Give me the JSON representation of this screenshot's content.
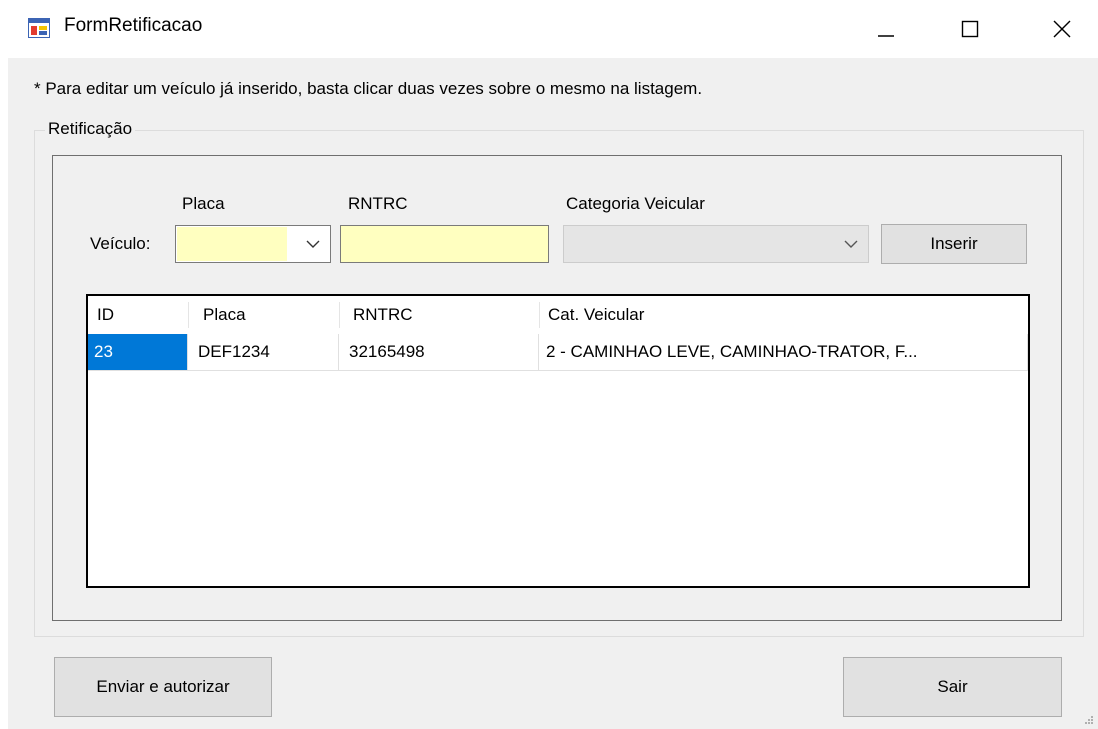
{
  "window": {
    "title": "FormRetificacao",
    "icon": "form-app-icon",
    "controls": [
      "minimize-icon",
      "maximize-icon",
      "close-icon"
    ]
  },
  "hint": "* Para editar um veículo já inserido, basta clicar duas vezes sobre o mesmo na listagem.",
  "group": {
    "label": "Retificação"
  },
  "form": {
    "veiculo_label": "Veículo:",
    "placa_label": "Placa",
    "placa_value": "",
    "rntrc_label": "RNTRC",
    "rntrc_value": "",
    "categoria_label": "Categoria Veicular",
    "categoria_value": "",
    "inserir_label": "Inserir"
  },
  "table": {
    "columns": [
      "ID",
      "Placa",
      "RNTRC",
      "Cat. Veicular"
    ],
    "rows": [
      [
        "23",
        "DEF1234",
        "32165498",
        "2 - CAMINHAO LEVE, CAMINHAO-TRATOR, F..."
      ]
    ]
  },
  "buttons": {
    "enviar_label": "Enviar e autorizar",
    "sair_label": "Sair"
  },
  "colors": {
    "input_required": "#ffffc0",
    "selection": "#0078d7",
    "client_bg": "#f0f0f0"
  }
}
